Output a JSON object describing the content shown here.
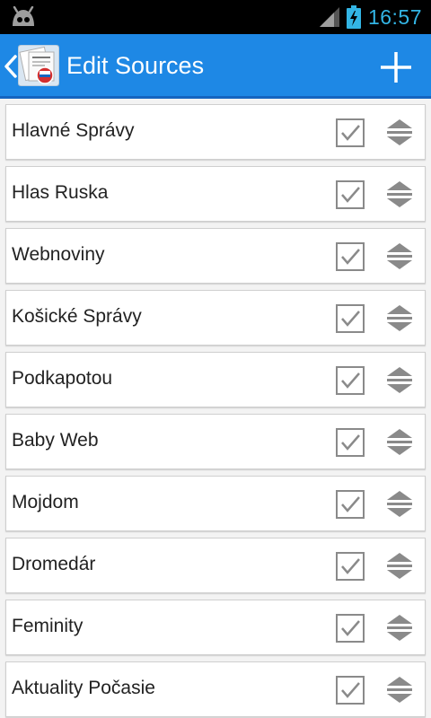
{
  "status_bar": {
    "time": "16:57",
    "icons": [
      "android-icon",
      "signal-icon",
      "battery-charging-icon"
    ]
  },
  "action_bar": {
    "title": "Edit Sources",
    "icons": [
      "back-chevron-icon",
      "app-newspaper-icon",
      "add-icon"
    ]
  },
  "sources": [
    {
      "label": "Hlavné Správy",
      "checked": true
    },
    {
      "label": "Hlas Ruska",
      "checked": true
    },
    {
      "label": "Webnoviny",
      "checked": true
    },
    {
      "label": "Košické Správy",
      "checked": true
    },
    {
      "label": "Podkapotou",
      "checked": true
    },
    {
      "label": "Baby Web",
      "checked": true
    },
    {
      "label": "Mojdom",
      "checked": true
    },
    {
      "label": "Dromedár",
      "checked": true
    },
    {
      "label": "Feminity",
      "checked": true
    },
    {
      "label": "Aktuality Počasie",
      "checked": true
    }
  ],
  "colors": {
    "action_bar": "#1e88e5",
    "status_accent": "#33b5e5",
    "background": "#f3f3f3"
  }
}
